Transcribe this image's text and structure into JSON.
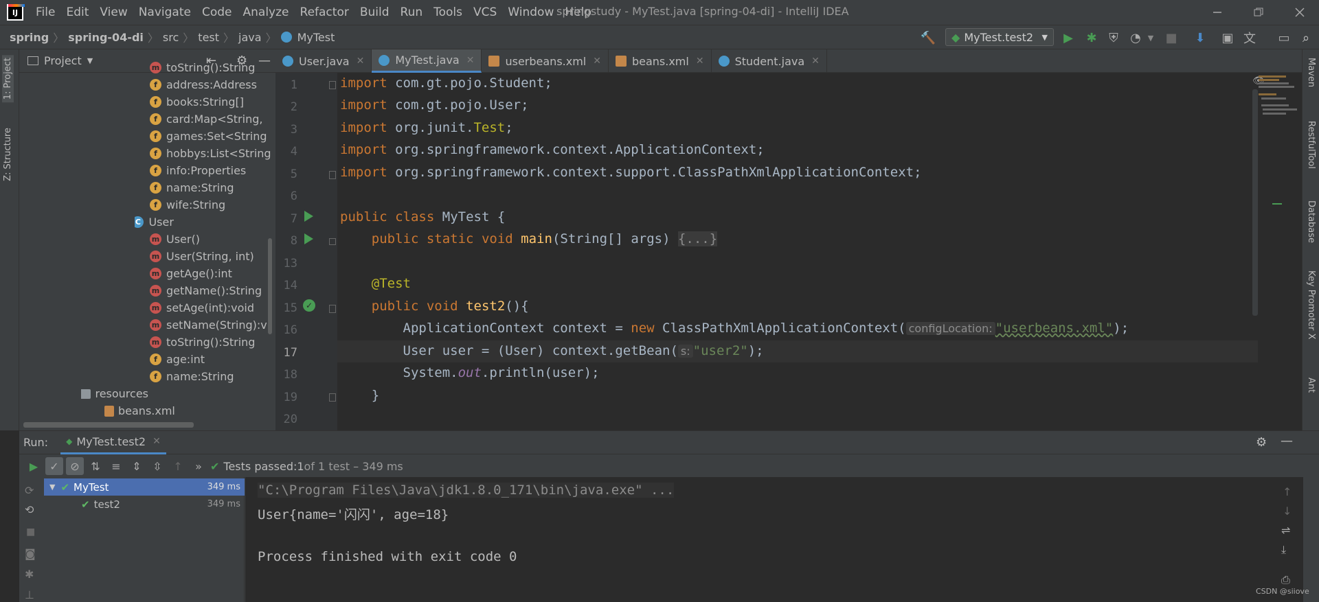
{
  "window": {
    "title": "springstudy - MyTest.java [spring-04-di] - IntelliJ IDEA",
    "menu": [
      "File",
      "Edit",
      "View",
      "Navigate",
      "Code",
      "Analyze",
      "Refactor",
      "Build",
      "Run",
      "Tools",
      "VCS",
      "Window",
      "Help"
    ],
    "app_icon": "IJ"
  },
  "breadcrumb": [
    "spring",
    "spring-04-di",
    "src",
    "test",
    "java",
    "MyTest"
  ],
  "toolbar": {
    "run_config": "MyTest.test2"
  },
  "left_stripe": [
    "1: Project",
    "Z: Structure"
  ],
  "project_panel": {
    "title": "Project",
    "items": [
      {
        "kind": "m",
        "label": "toString():String"
      },
      {
        "kind": "f",
        "label": "address:Address"
      },
      {
        "kind": "f",
        "label": "books:String[]"
      },
      {
        "kind": "f",
        "label": "card:Map<String,"
      },
      {
        "kind": "f",
        "label": "games:Set<String"
      },
      {
        "kind": "f",
        "label": "hobbys:List<String"
      },
      {
        "kind": "f",
        "label": "info:Properties"
      },
      {
        "kind": "f",
        "label": "name:String"
      },
      {
        "kind": "f",
        "label": "wife:String"
      },
      {
        "kind": "c",
        "label": "User"
      },
      {
        "kind": "m",
        "label": "User()"
      },
      {
        "kind": "m",
        "label": "User(String, int)"
      },
      {
        "kind": "m",
        "label": "getAge():int"
      },
      {
        "kind": "m",
        "label": "getName():String"
      },
      {
        "kind": "m",
        "label": "setAge(int):void"
      },
      {
        "kind": "m",
        "label": "setName(String):v"
      },
      {
        "kind": "m",
        "label": "toString():String"
      },
      {
        "kind": "f",
        "label": "age:int"
      },
      {
        "kind": "f",
        "label": "name:String"
      },
      {
        "kind": "folder",
        "label": "resources"
      },
      {
        "kind": "xml",
        "label": "beans.xml"
      }
    ]
  },
  "tabs": [
    {
      "label": "User.java",
      "icon": "class-icon"
    },
    {
      "label": "MyTest.java",
      "icon": "class-icon",
      "active": true
    },
    {
      "label": "userbeans.xml",
      "icon": "xml-icon"
    },
    {
      "label": "beans.xml",
      "icon": "xml-icon"
    },
    {
      "label": "Student.java",
      "icon": "class-icon"
    }
  ],
  "editor": {
    "line_numbers": [
      "1",
      "2",
      "3",
      "4",
      "5",
      "6",
      "7",
      "8",
      "13",
      "14",
      "15",
      "16",
      "17",
      "18",
      "19",
      "20"
    ],
    "import1": "com.gt.pojo.Student;",
    "import2": "com.gt.pojo.User;",
    "import3a": "org.junit.",
    "import3b": "Test",
    "import3c": ";",
    "import4": "org.springframework.context.ApplicationContext;",
    "import5": "org.springframework.context.support.ClassPathXmlApplicationContext;",
    "kw_import": "import",
    "kw_public": "public",
    "kw_class": "class",
    "class_name": "MyTest {",
    "kw_static": "static",
    "kw_void": "void",
    "main_name": "main",
    "main_params": "(String[] args) ",
    "folded": "{...}",
    "annotation": "@Test",
    "test_name": "test2",
    "test_open": "(){",
    "line16a": "ApplicationContext context = ",
    "kw_new": "new",
    "line16b": " ClassPathXmlApplicationContext(",
    "hint16": "configLocation:",
    "str16": "\"userbeans.xml\"",
    "line16c": ");",
    "line17a": "User user = (User) context.getBean(",
    "hint17": "s:",
    "str17": "\"user2\"",
    "line17c": ");",
    "line18a": "System.",
    "line18b": "out",
    "line18c": ".println(user);",
    "close_brace": "}"
  },
  "right_stripe": [
    "Maven",
    "RestfulTool",
    "Database",
    "Key Promoter X",
    "Ant"
  ],
  "run_panel": {
    "label": "Run:",
    "tab": "MyTest.test2",
    "status_prefix": "Tests passed: ",
    "status_count": "1",
    "status_suffix": " of 1 test – 349 ms",
    "tests": [
      {
        "name": "MyTest",
        "time": "349 ms"
      },
      {
        "name": "test2",
        "time": "349 ms"
      }
    ],
    "console": [
      "\"C:\\Program Files\\Java\\jdk1.8.0_171\\bin\\java.exe\" ...",
      "User{name='闪闪', age=18}",
      "Process finished with exit code 0"
    ]
  },
  "watermark": "CSDN @siiove",
  "colors": {
    "accent": "#4a88c7",
    "keyword": "#cc7832",
    "string": "#6a8759",
    "run_green": "#499c54"
  }
}
